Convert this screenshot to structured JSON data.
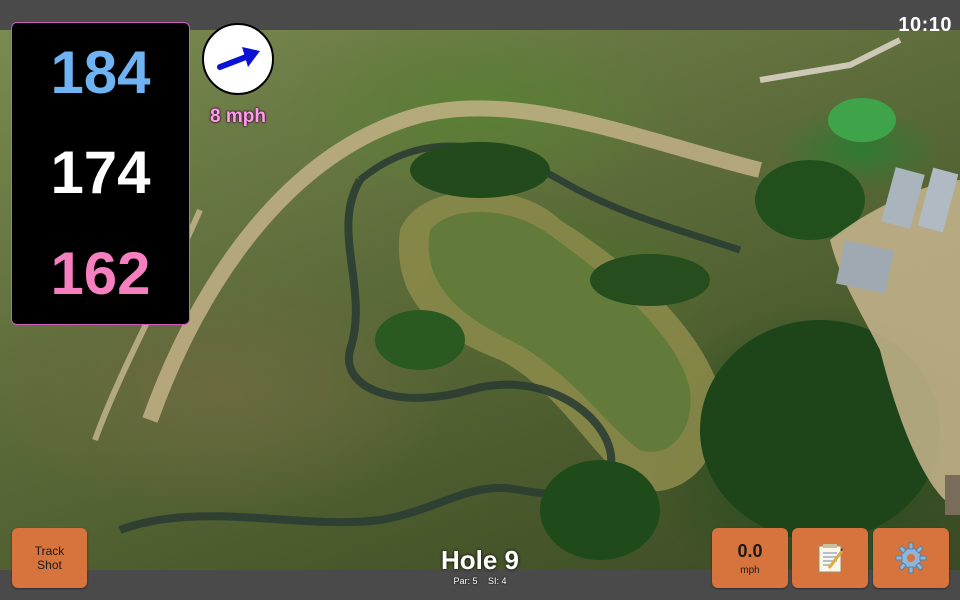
{
  "status_bar": {
    "time": "10:10"
  },
  "yardages": {
    "back": "184",
    "center": "174",
    "front": "162"
  },
  "wind": {
    "speed": "8 mph",
    "icon": "arrow-icon"
  },
  "hole": {
    "title": "Hole 9",
    "par": "Par: 5",
    "si": "SI: 4"
  },
  "buttons": {
    "track_shot": "Track Shot",
    "speed_value": "0.0",
    "speed_unit": "mph",
    "notes_icon": "notepad-icon",
    "settings_icon": "gear-icon"
  },
  "colors": {
    "accent": "#d7743e",
    "back_yardage": "#6fb3f2",
    "center_yardage": "#ffffff",
    "front_yardage": "#f57fbf",
    "wind_text": "#ff9ce8"
  }
}
